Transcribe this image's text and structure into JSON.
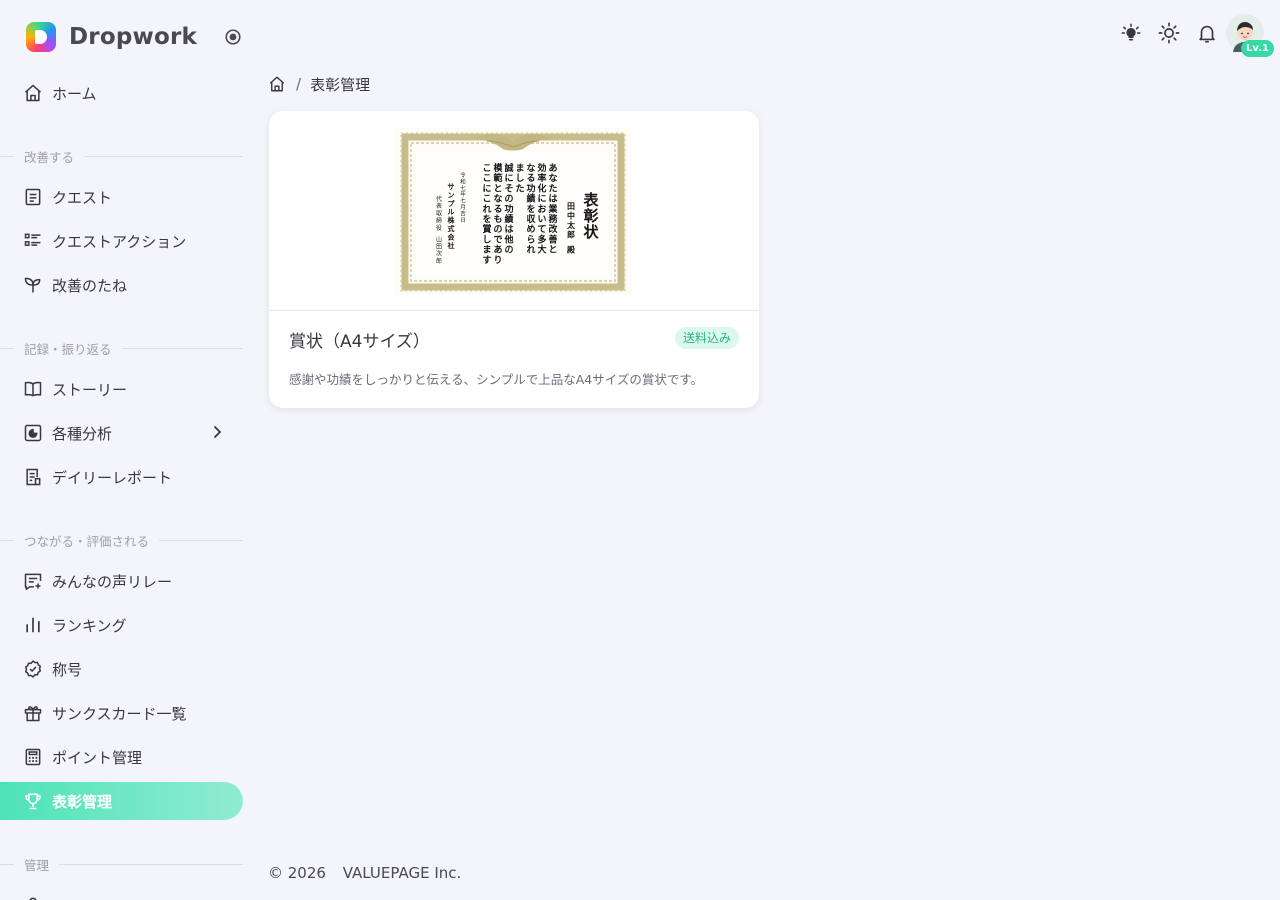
{
  "brand": {
    "name": "Dropwork"
  },
  "nav": {
    "home": "ホーム",
    "section_improve": "改善する",
    "quest": "クエスト",
    "quest_action": "クエストアクション",
    "seeds": "改善のたね",
    "section_record": "記録・振り返る",
    "story": "ストーリー",
    "analysis": "各種分析",
    "daily_report": "デイリーレポート",
    "section_connect": "つながる・評価される",
    "voice_relay": "みんなの声リレー",
    "ranking": "ランキング",
    "title": "称号",
    "thanks_cards": "サンクスカード一覧",
    "points": "ポイント管理",
    "awards": "表彰管理",
    "section_admin": "管理"
  },
  "user": {
    "level": "Lv.1"
  },
  "breadcrumb": {
    "current": "表彰管理"
  },
  "card": {
    "title": "賞状（A4サイズ）",
    "chip": "送料込み",
    "description": "感謝や功績をしっかりと伝える、シンプルで上品なA4サイズの賞状です。"
  },
  "certificate": {
    "heading": "表彰状",
    "recipient": "田中太郎 殿",
    "body": [
      "あなたは業務改善と",
      "効率化において多大",
      "なる功績を収められ",
      "ました",
      "誠にその功績は他の",
      "模範となるものであり",
      "ここにこれを賞します"
    ],
    "date": "令和七年七月吉日",
    "company": "サンプル株式会社",
    "signer": "代表取締役 山田次郎"
  },
  "footer": {
    "copyright": "© 2026",
    "company": "VALUEPAGE Inc."
  },
  "colors": {
    "accent": "#4ee3b6",
    "chip_bg": "#dbf7ee",
    "chip_text": "#24b987",
    "background": "#f4f5fa"
  }
}
